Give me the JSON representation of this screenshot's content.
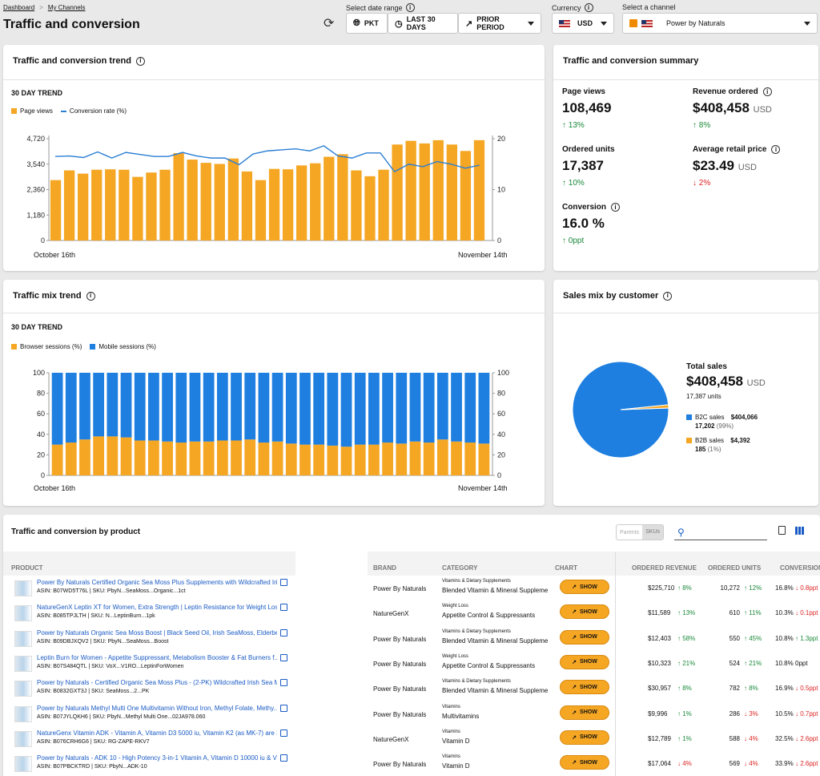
{
  "breadcrumb": {
    "items": [
      "Dashboard",
      "My Channels"
    ]
  },
  "page_title": "Traffic and conversion",
  "controls": {
    "date_range_label": "Select date range",
    "timezone": "PKT",
    "range": "LAST 30 DAYS",
    "compare": "PRIOR PERIOD",
    "currency_label": "Currency",
    "currency": "USD",
    "channel_label": "Select a channel",
    "channel": "Power by Naturals"
  },
  "trend_card": {
    "title": "Traffic and conversion trend",
    "subtitle": "30 DAY TREND",
    "legend": [
      "Page views",
      "Conversion rate (%)"
    ],
    "x_start": "October 16th",
    "x_end": "November 14th"
  },
  "mix_card": {
    "title": "Traffic mix trend",
    "subtitle": "30 DAY TREND",
    "legend": [
      "Browser sessions (%)",
      "Mobile sessions (%)"
    ],
    "x_start": "October 16th",
    "x_end": "November 14th"
  },
  "summary": {
    "title": "Traffic and conversion summary",
    "page_views": {
      "label": "Page views",
      "value": "108,469",
      "change": "13%"
    },
    "revenue": {
      "label": "Revenue ordered",
      "value": "$408,458",
      "unit": "USD",
      "change": "8%"
    },
    "units": {
      "label": "Ordered units",
      "value": "17,387",
      "change": "10%"
    },
    "arp": {
      "label": "Average retail price",
      "value": "$23.49",
      "unit": "USD",
      "change": "2%"
    },
    "conversion": {
      "label": "Conversion",
      "value": "16.0 %",
      "change": "0ppt"
    }
  },
  "sales_mix": {
    "title": "Sales mix by customer",
    "total_label": "Total sales",
    "total_value": "$408,458",
    "total_unit": "USD",
    "total_units": "17,387 units",
    "b2c": {
      "label": "B2C sales",
      "value": "$404,066",
      "units": "17,202",
      "pct": "(99%)"
    },
    "b2b": {
      "label": "B2B sales",
      "value": "$4,392",
      "units": "185",
      "pct": "(1%)"
    }
  },
  "product_table": {
    "title": "Traffic and conversion by product",
    "toggle": [
      "Parents",
      "SKUs"
    ],
    "headers": [
      "PRODUCT",
      "BRAND",
      "CATEGORY",
      "CHART",
      "ORDERED REVENUE",
      "ORDERED UNITS",
      "CONVERSION"
    ],
    "show_label": "SHOW",
    "rows": [
      {
        "name": "Power By Naturals Certified Organic Sea Moss Plus Supplements with Wildcrafted Iris...",
        "sub": "ASIN: B07WD5T76L | SKU: PbyN...SeaMoss...Organic...1ct",
        "brand": "Power By Naturals",
        "cat1": "Vitamins & Dietary Supplements",
        "cat2": "Blended Vitamin & Mineral Suppleme",
        "rev": "$225,710",
        "rev_ch": "8%",
        "rev_up": true,
        "units": "10,272",
        "units_ch": "12%",
        "units_up": true,
        "conv": "16.8%",
        "conv_ch": "0.8ppt",
        "conv_up": false
      },
      {
        "name": "NatureGenX Leptin XT for Women, Extra Strength | Leptin Resistance for Weight Loss ...",
        "sub": "ASIN: B085TPJLTH | SKU: N...LeptinBurn...1pk",
        "brand": "NatureGenX",
        "cat1": "Weight Loss",
        "cat2": "Appetite Control & Suppressants",
        "rev": "$11,589",
        "rev_ch": "13%",
        "rev_up": true,
        "units": "610",
        "units_ch": "11%",
        "units_up": true,
        "conv": "10.3%",
        "conv_ch": "0.1ppt",
        "conv_up": false
      },
      {
        "name": "Power by Naturals Organic Sea Moss Boost | Black Seed Oil, Irish SeaMoss, Elderberry...",
        "sub": "ASIN: B09DBJXQV2 | SKU: PbyN...SeaMoss...Boost",
        "brand": "Power By Naturals",
        "cat1": "Vitamins & Dietary Supplements",
        "cat2": "Blended Vitamin & Mineral Suppleme",
        "rev": "$12,403",
        "rev_ch": "58%",
        "rev_up": true,
        "units": "550",
        "units_ch": "45%",
        "units_up": true,
        "conv": "10.8%",
        "conv_ch": "1.3ppt",
        "conv_up": true
      },
      {
        "name": "Leptin Burn for Women - Appetite Suppressant, Metabolism Booster & Fat Burners f...",
        "sub": "ASIN: B07S484QTL | SKU: VoX...V1RO...LeptinForWomen",
        "brand": "Power By Naturals",
        "cat1": "Weight Loss",
        "cat2": "Appetite Control & Suppressants",
        "rev": "$10,323",
        "rev_ch": "21%",
        "rev_up": true,
        "units": "524",
        "units_ch": "21%",
        "units_up": true,
        "conv": "10.8%",
        "conv_ch": "0ppt",
        "conv_up": null
      },
      {
        "name": "Power by Naturals - Certified Organic Sea Moss Plus - (2-PK) Wildcrafted Irish Sea M...",
        "sub": "ASIN: B0832GXT3J | SKU: SeaMoss...2...PK",
        "brand": "Power By Naturals",
        "cat1": "Vitamins & Dietary Supplements",
        "cat2": "Blended Vitamin & Mineral Suppleme",
        "rev": "$30,957",
        "rev_ch": "8%",
        "rev_up": true,
        "units": "782",
        "units_ch": "8%",
        "units_up": true,
        "conv": "16.9%",
        "conv_ch": "0.5ppt",
        "conv_up": false
      },
      {
        "name": "Power by Naturals Methyl Multi One Multivitamin Without Iron, Methyl Folate, Methy...",
        "sub": "ASIN: B07JYLQKH6 | SKU: PbyN...Methyl Multi One...02JA978.060",
        "brand": "Power By Naturals",
        "cat1": "Vitamins",
        "cat2": "Multivitamins",
        "rev": "$9,996",
        "rev_ch": "1%",
        "rev_up": true,
        "units": "286",
        "units_ch": "3%",
        "units_up": false,
        "conv": "10.5%",
        "conv_ch": "0.7ppt",
        "conv_up": false
      },
      {
        "name": "NatureGenx Vitamin ADK - Vitamin A, Vitamin D3 5000 iu, Vitamin K2 (as MK-7) are 3...",
        "sub": "ASIN: B076CRH6G6 | SKU: RG-ZAPE-RKV7",
        "brand": "NatureGenX",
        "cat1": "Vitamins",
        "cat2": "Vitamin D",
        "rev": "$12,789",
        "rev_ch": "1%",
        "rev_up": true,
        "units": "588",
        "units_ch": "4%",
        "units_up": false,
        "conv": "32.5%",
        "conv_ch": "2.6ppt",
        "conv_up": false
      },
      {
        "name": "Power by Naturals - ADK 10 - High Potency 3-in-1 Vitamin A, Vitamin D 10000 iu & Vit...",
        "sub": "ASIN: B07PBCKTRD | SKU: PbyN...ADK-10",
        "brand": "Power By Naturals",
        "cat1": "Vitamins",
        "cat2": "Vitamin D",
        "rev": "$17,064",
        "rev_ch": "4%",
        "rev_up": false,
        "units": "569",
        "units_ch": "4%",
        "units_up": false,
        "conv": "33.9%",
        "conv_ch": "2.6ppt",
        "conv_up": false
      }
    ]
  },
  "colors": {
    "orange": "#f5a623",
    "blue": "#1e7fe0",
    "line": "#2a7fd4"
  },
  "chart_data": [
    {
      "type": "bar",
      "title": "30 DAY TREND",
      "categories": [
        "Oct 16",
        "Oct 17",
        "Oct 18",
        "Oct 19",
        "Oct 20",
        "Oct 21",
        "Oct 22",
        "Oct 23",
        "Oct 24",
        "Oct 25",
        "Oct 26",
        "Oct 27",
        "Oct 28",
        "Oct 29",
        "Oct 30",
        "Oct 31",
        "Nov 1",
        "Nov 2",
        "Nov 3",
        "Nov 4",
        "Nov 5",
        "Nov 6",
        "Nov 7",
        "Nov 8",
        "Nov 9",
        "Nov 10",
        "Nov 11",
        "Nov 12",
        "Nov 13",
        "Nov 14"
      ],
      "series": [
        {
          "name": "Page views",
          "axis": "left",
          "values": [
            2800,
            3250,
            3100,
            3280,
            3300,
            3280,
            2950,
            3150,
            3280,
            4050,
            3750,
            3600,
            3550,
            3800,
            3200,
            2800,
            3320,
            3300,
            3480,
            3580,
            3880,
            4000,
            3250,
            2980,
            3280,
            4450,
            4620,
            4500,
            4650,
            4450,
            4150,
            4650
          ]
        },
        {
          "name": "Conversion rate (%)",
          "axis": "right",
          "values": [
            16.5,
            16.6,
            16.3,
            17.4,
            16.2,
            17.3,
            16.9,
            16.5,
            16.5,
            17.3,
            16.6,
            16.2,
            16.2,
            14.9,
            17.0,
            17.6,
            17.8,
            18.0,
            17.6,
            18.6,
            16.6,
            16.2,
            17.2,
            17.2,
            13.5,
            15.0,
            14.5,
            15.5,
            15.0,
            14.2,
            14.8
          ]
        }
      ],
      "ylim_left": [
        0,
        4720
      ],
      "yticks_left": [
        "0",
        "1,180",
        "2,360",
        "3,540",
        "4,720"
      ],
      "ylim_right": [
        0,
        20
      ],
      "yticks_right": [
        "0",
        "10",
        "20"
      ]
    },
    {
      "type": "bar",
      "title": "30 DAY TREND",
      "stacked": true,
      "series": [
        {
          "name": "Browser sessions (%)",
          "values": [
            30,
            32,
            35,
            38,
            38,
            37,
            34,
            34,
            33,
            32,
            33,
            33,
            34,
            34,
            35,
            32,
            33,
            31,
            30,
            30,
            29,
            28,
            30,
            30,
            32,
            31,
            33,
            32,
            35,
            33,
            32,
            31
          ]
        },
        {
          "name": "Mobile sessions (%)",
          "values": [
            70,
            68,
            65,
            62,
            62,
            63,
            66,
            66,
            67,
            68,
            67,
            67,
            66,
            66,
            65,
            68,
            67,
            69,
            70,
            70,
            71,
            72,
            70,
            70,
            68,
            69,
            67,
            68,
            65,
            67,
            68,
            69
          ]
        }
      ],
      "ylim": [
        0,
        100
      ],
      "yticks": [
        "0",
        "20",
        "40",
        "60",
        "80",
        "100"
      ]
    },
    {
      "type": "pie",
      "labels": [
        "B2C sales",
        "B2B sales"
      ],
      "values": [
        404066,
        4392
      ]
    }
  ]
}
